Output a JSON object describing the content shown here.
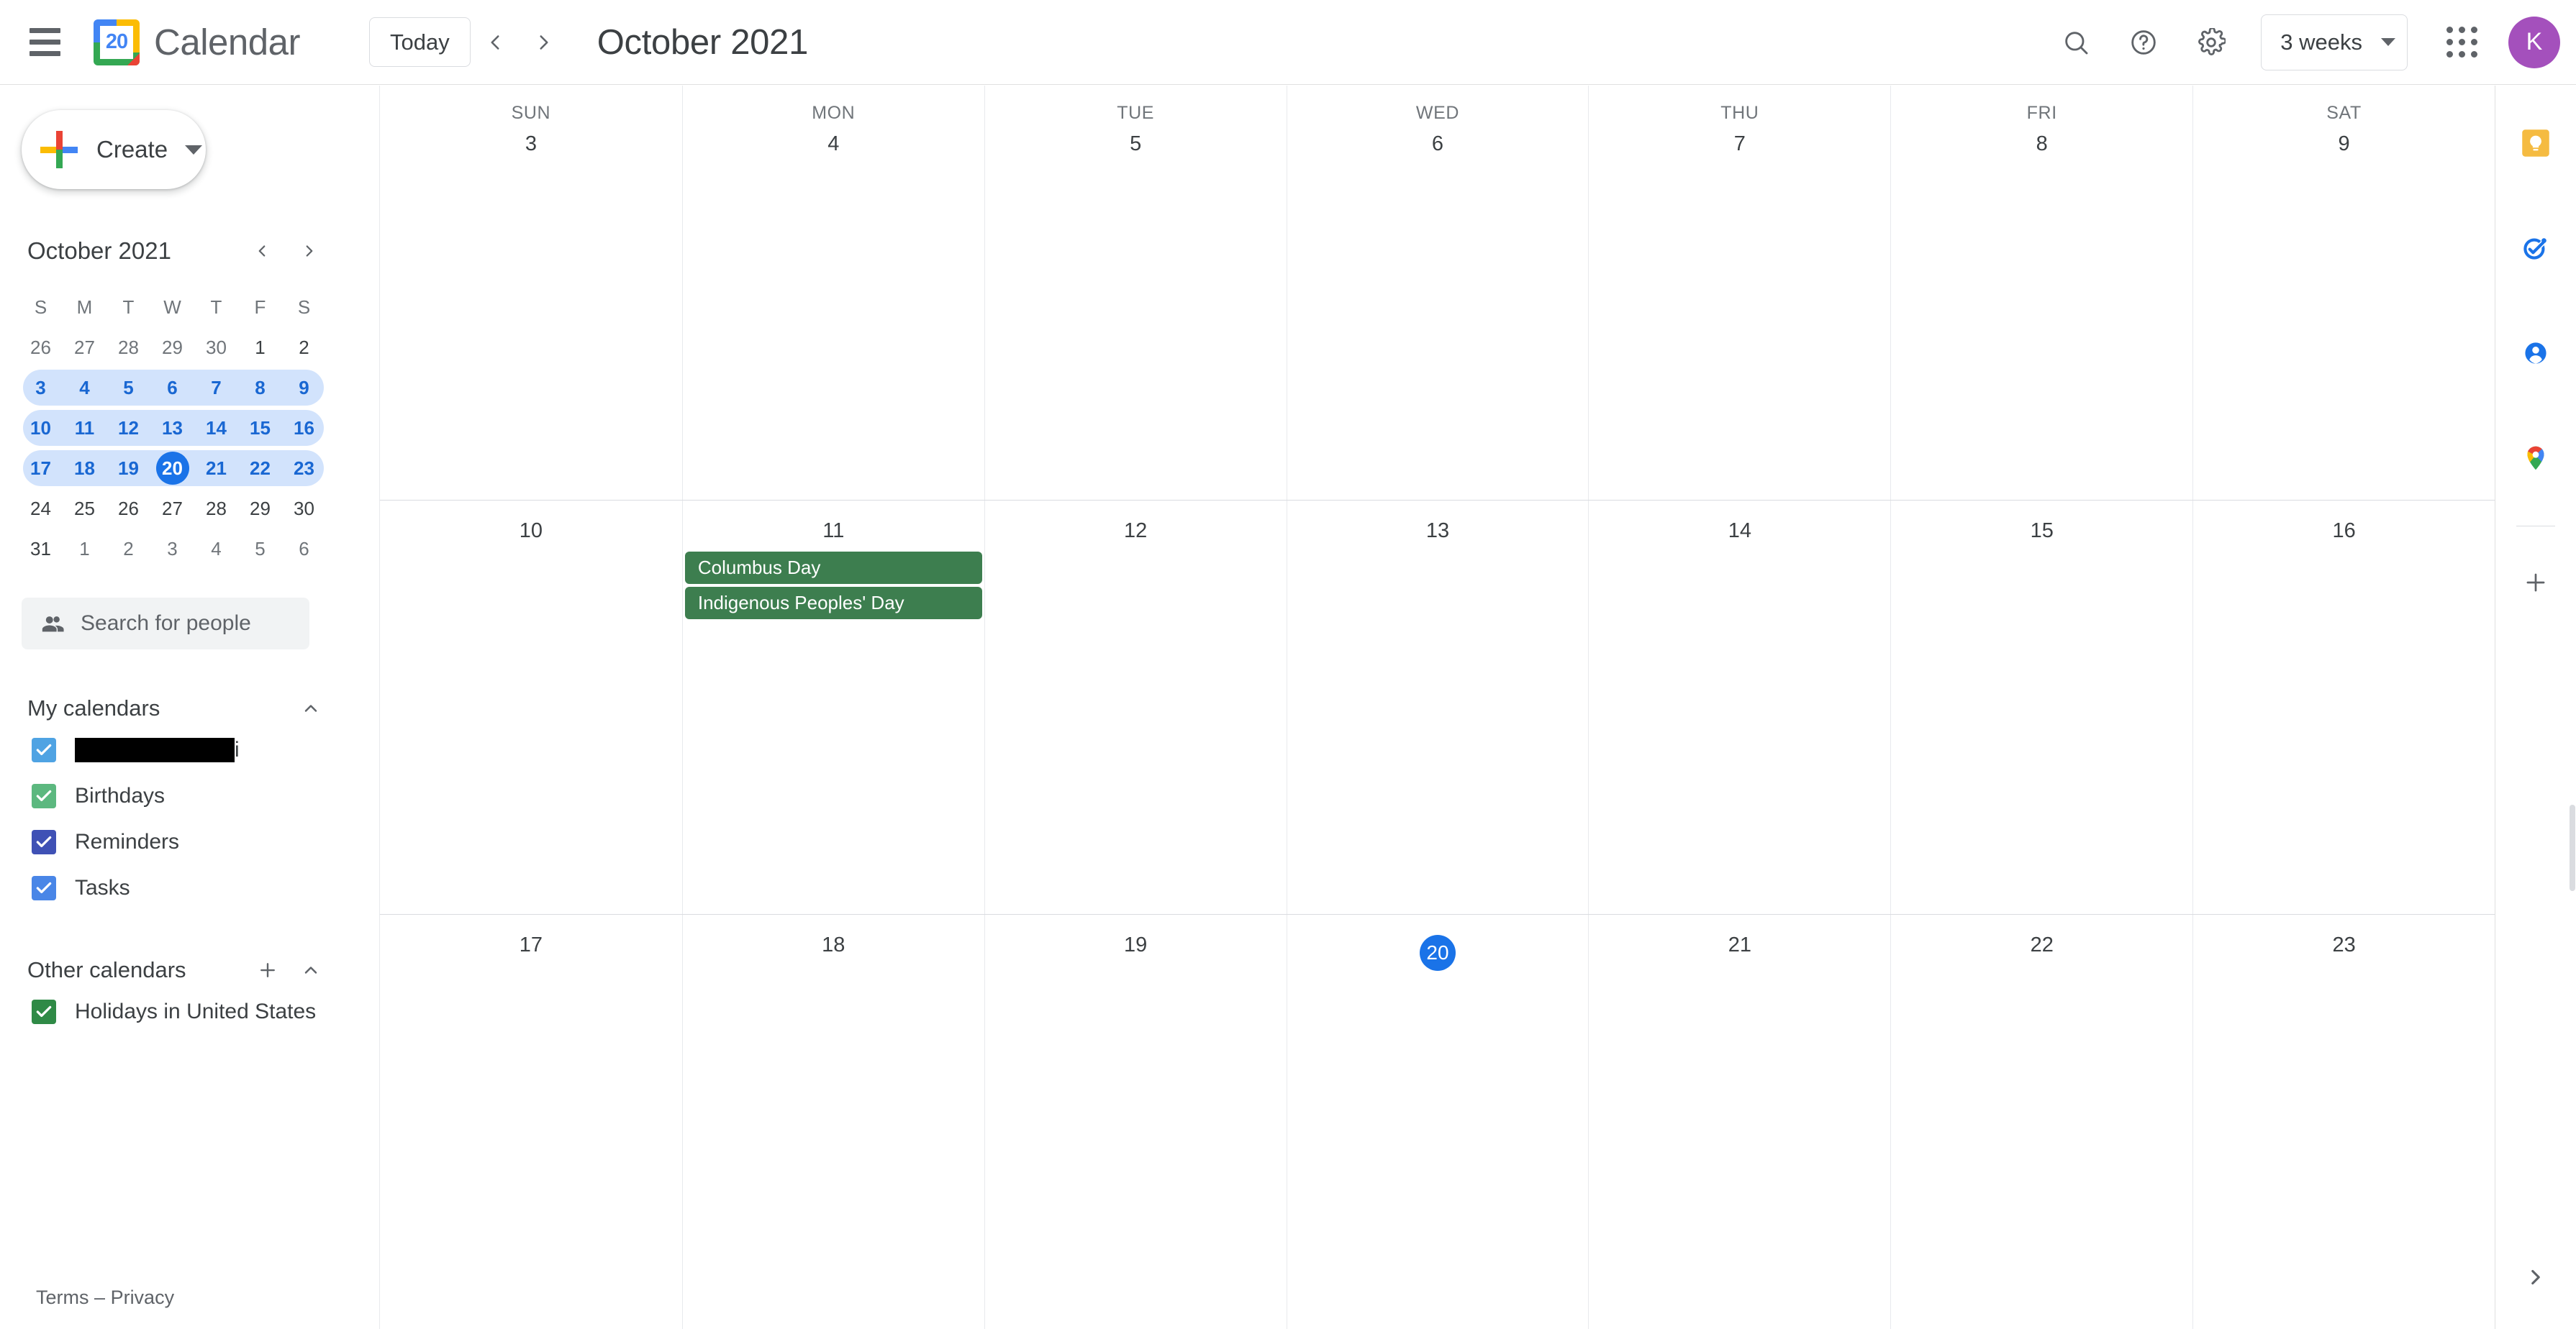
{
  "app": {
    "title": "Calendar",
    "logo_day": "20",
    "avatar_letter": "K",
    "avatar_color": "#A450BC"
  },
  "topbar": {
    "menu_label": "Main menu",
    "today_label": "Today",
    "prev_label": "Previous period",
    "next_label": "Next period",
    "period_title": "October 2021",
    "search_label": "Search",
    "help_label": "Support",
    "settings_label": "Settings menu",
    "view_label": "3 weeks",
    "apps_label": "Google apps"
  },
  "sidebar": {
    "create_label": "Create",
    "mini_calendar": {
      "title": "October 2021",
      "dow": [
        "S",
        "M",
        "T",
        "W",
        "T",
        "F",
        "S"
      ],
      "rows": [
        {
          "highlight": false,
          "cells": [
            {
              "n": "26",
              "state": "muted"
            },
            {
              "n": "27",
              "state": "muted"
            },
            {
              "n": "28",
              "state": "muted"
            },
            {
              "n": "29",
              "state": "muted"
            },
            {
              "n": "30",
              "state": "muted"
            },
            {
              "n": "1",
              "state": "normal"
            },
            {
              "n": "2",
              "state": "normal"
            }
          ]
        },
        {
          "highlight": true,
          "cells": [
            {
              "n": "3",
              "state": "inrange"
            },
            {
              "n": "4",
              "state": "inrange"
            },
            {
              "n": "5",
              "state": "inrange"
            },
            {
              "n": "6",
              "state": "inrange"
            },
            {
              "n": "7",
              "state": "inrange"
            },
            {
              "n": "8",
              "state": "inrange"
            },
            {
              "n": "9",
              "state": "inrange"
            }
          ]
        },
        {
          "highlight": true,
          "cells": [
            {
              "n": "10",
              "state": "inrange"
            },
            {
              "n": "11",
              "state": "inrange"
            },
            {
              "n": "12",
              "state": "inrange"
            },
            {
              "n": "13",
              "state": "inrange"
            },
            {
              "n": "14",
              "state": "inrange"
            },
            {
              "n": "15",
              "state": "inrange"
            },
            {
              "n": "16",
              "state": "inrange"
            }
          ]
        },
        {
          "highlight": true,
          "cells": [
            {
              "n": "17",
              "state": "inrange"
            },
            {
              "n": "18",
              "state": "inrange"
            },
            {
              "n": "19",
              "state": "inrange"
            },
            {
              "n": "20",
              "state": "today"
            },
            {
              "n": "21",
              "state": "inrange"
            },
            {
              "n": "22",
              "state": "inrange"
            },
            {
              "n": "23",
              "state": "inrange"
            }
          ]
        },
        {
          "highlight": false,
          "cells": [
            {
              "n": "24",
              "state": "normal"
            },
            {
              "n": "25",
              "state": "normal"
            },
            {
              "n": "26",
              "state": "normal"
            },
            {
              "n": "27",
              "state": "normal"
            },
            {
              "n": "28",
              "state": "normal"
            },
            {
              "n": "29",
              "state": "normal"
            },
            {
              "n": "30",
              "state": "normal"
            }
          ]
        },
        {
          "highlight": false,
          "cells": [
            {
              "n": "31",
              "state": "normal"
            },
            {
              "n": "1",
              "state": "muted"
            },
            {
              "n": "2",
              "state": "muted"
            },
            {
              "n": "3",
              "state": "muted"
            },
            {
              "n": "4",
              "state": "muted"
            },
            {
              "n": "5",
              "state": "muted"
            },
            {
              "n": "6",
              "state": "muted"
            }
          ]
        }
      ]
    },
    "people_search_placeholder": "Search for people",
    "my_calendars": {
      "title": "My calendars",
      "items": [
        {
          "label": "",
          "redacted": true,
          "tail": "i",
          "color": "#4fa3e3",
          "checked": true
        },
        {
          "label": "Birthdays",
          "redacted": false,
          "tail": "",
          "color": "#5cb87f",
          "checked": true
        },
        {
          "label": "Reminders",
          "redacted": false,
          "tail": "",
          "color": "#3f51b5",
          "checked": true
        },
        {
          "label": "Tasks",
          "redacted": false,
          "tail": "",
          "color": "#4986e7",
          "checked": true
        }
      ]
    },
    "other_calendars": {
      "title": "Other calendars",
      "add_label": "Add other calendars",
      "items": [
        {
          "label": "Holidays in United States",
          "color": "#2f8a46",
          "checked": true
        }
      ]
    },
    "footer": {
      "terms": "Terms",
      "separator": "–",
      "privacy": "Privacy"
    }
  },
  "grid": {
    "weeks": [
      {
        "show_dow": true,
        "days": [
          {
            "dow": "SUN",
            "num": "3",
            "today": false,
            "events": []
          },
          {
            "dow": "MON",
            "num": "4",
            "today": false,
            "events": []
          },
          {
            "dow": "TUE",
            "num": "5",
            "today": false,
            "events": []
          },
          {
            "dow": "WED",
            "num": "6",
            "today": false,
            "events": []
          },
          {
            "dow": "THU",
            "num": "7",
            "today": false,
            "events": []
          },
          {
            "dow": "FRI",
            "num": "8",
            "today": false,
            "events": []
          },
          {
            "dow": "SAT",
            "num": "9",
            "today": false,
            "events": []
          }
        ]
      },
      {
        "show_dow": false,
        "days": [
          {
            "dow": "",
            "num": "10",
            "today": false,
            "events": []
          },
          {
            "dow": "",
            "num": "11",
            "today": false,
            "events": [
              {
                "title": "Columbus Day",
                "color": "#3d7e4f"
              },
              {
                "title": "Indigenous Peoples' Day",
                "color": "#3d7e4f"
              }
            ]
          },
          {
            "dow": "",
            "num": "12",
            "today": false,
            "events": []
          },
          {
            "dow": "",
            "num": "13",
            "today": false,
            "events": []
          },
          {
            "dow": "",
            "num": "14",
            "today": false,
            "events": []
          },
          {
            "dow": "",
            "num": "15",
            "today": false,
            "events": []
          },
          {
            "dow": "",
            "num": "16",
            "today": false,
            "events": []
          }
        ]
      },
      {
        "show_dow": false,
        "days": [
          {
            "dow": "",
            "num": "17",
            "today": false,
            "events": []
          },
          {
            "dow": "",
            "num": "18",
            "today": false,
            "events": []
          },
          {
            "dow": "",
            "num": "19",
            "today": false,
            "events": []
          },
          {
            "dow": "",
            "num": "20",
            "today": true,
            "events": []
          },
          {
            "dow": "",
            "num": "21",
            "today": false,
            "events": []
          },
          {
            "dow": "",
            "num": "22",
            "today": false,
            "events": []
          },
          {
            "dow": "",
            "num": "23",
            "today": false,
            "events": []
          }
        ]
      }
    ]
  },
  "rail": {
    "items": [
      {
        "name": "keep-icon",
        "label": "Keep"
      },
      {
        "name": "tasks-icon",
        "label": "Tasks"
      },
      {
        "name": "contacts-icon",
        "label": "Contacts"
      },
      {
        "name": "maps-icon",
        "label": "Maps"
      }
    ],
    "add_label": "Get add-ons",
    "expand_label": "Show side panel"
  }
}
